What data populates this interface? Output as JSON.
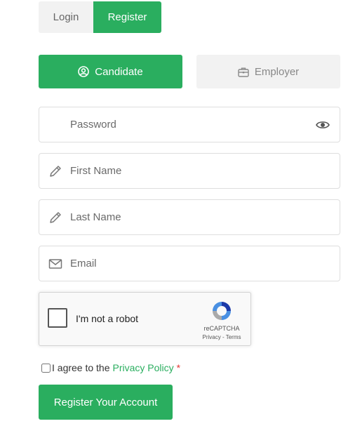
{
  "tabs": {
    "login_label": "Login",
    "register_label": "Register"
  },
  "roles": {
    "candidate_label": "Candidate",
    "employer_label": "Employer"
  },
  "form": {
    "password_placeholder": "Password",
    "first_name_placeholder": "First Name",
    "last_name_placeholder": "Last Name",
    "email_placeholder": "Email"
  },
  "captcha": {
    "label": "I'm not a robot",
    "brand": "reCAPTCHA",
    "privacy": "Privacy",
    "separator": " - ",
    "terms": "Terms"
  },
  "agree": {
    "text": "I agree to the",
    "link": "Privacy Policy",
    "required_mark": "*"
  },
  "submit_label": "Register Your Account",
  "colors": {
    "accent": "#2aae5f",
    "muted_bg": "#f2f2f2",
    "required": "#e53935"
  }
}
